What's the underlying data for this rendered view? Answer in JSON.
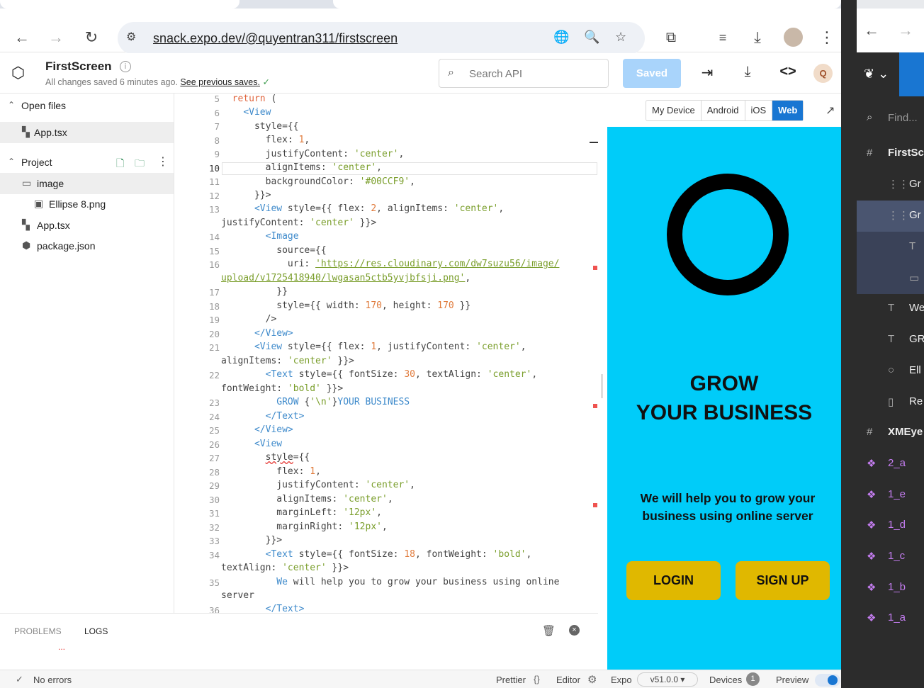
{
  "browser": {
    "url": "snack.expo.dev/@quyentran311/firstscreen"
  },
  "snack": {
    "title": "FirstScreen",
    "subtitle": "All changes saved 6 minutes ago.",
    "see_previous": "See previous saves.",
    "search_placeholder": "Search API",
    "saved_label": "Saved",
    "avatar_letter": "Q"
  },
  "sidebar": {
    "open_files_label": "Open files",
    "open_file": "App.tsx",
    "project_label": "Project",
    "tree": [
      {
        "label": "image"
      },
      {
        "label": "Ellipse 8.png"
      },
      {
        "label": "App.tsx"
      },
      {
        "label": "package.json"
      }
    ]
  },
  "editor": {
    "line_numbers": [
      "5",
      "6",
      "7",
      "8",
      "9",
      "10",
      "11",
      "12",
      "13",
      "",
      "14",
      "15",
      "16",
      "",
      "17",
      "18",
      "19",
      "20",
      "21",
      "",
      "22",
      "",
      "23",
      "24",
      "25",
      "26",
      "27",
      "28",
      "29",
      "30",
      "31",
      "32",
      "33",
      "34",
      "",
      "35",
      "",
      "36"
    ]
  },
  "panel": {
    "tab_problems": "PROBLEMS",
    "tab_logs": "LOGS",
    "dots": "..."
  },
  "status": {
    "errors": "No errors",
    "prettier": "Prettier",
    "editor": "Editor",
    "expo": "Expo",
    "expo_version": "v51.0.0",
    "devices": "Devices",
    "devices_count": "1",
    "preview": "Preview"
  },
  "preview": {
    "platforms": [
      "My Device",
      "Android",
      "iOS",
      "Web"
    ],
    "active_platform": "Web",
    "heading_line1": "GROW",
    "heading_line2": "YOUR BUSINESS",
    "help_text": "We will help you to grow your business using online server",
    "login": "LOGIN",
    "signup": "SIGN UP",
    "bg_color": "#00CCF9",
    "button_color": "#E0B800"
  },
  "figma": {
    "find_placeholder": "Find...",
    "layers": [
      {
        "icon": "#",
        "label": "FirstSc"
      },
      {
        "icon": "⋮⋮",
        "label": "Gr"
      },
      {
        "icon": "⋮⋮",
        "label": "Gr"
      },
      {
        "icon": "T",
        "label": ""
      },
      {
        "icon": "▭",
        "label": ""
      },
      {
        "icon": "T",
        "label": "We"
      },
      {
        "icon": "T",
        "label": "GR"
      },
      {
        "icon": "○",
        "label": "Ell"
      },
      {
        "icon": "▯",
        "label": "Re"
      },
      {
        "icon": "#",
        "label": "XMEye"
      },
      {
        "icon": "❖",
        "label": "2_a"
      },
      {
        "icon": "❖",
        "label": "1_e"
      },
      {
        "icon": "❖",
        "label": "1_d"
      },
      {
        "icon": "❖",
        "label": "1_c"
      },
      {
        "icon": "❖",
        "label": "1_b"
      },
      {
        "icon": "❖",
        "label": "1_a"
      }
    ]
  }
}
